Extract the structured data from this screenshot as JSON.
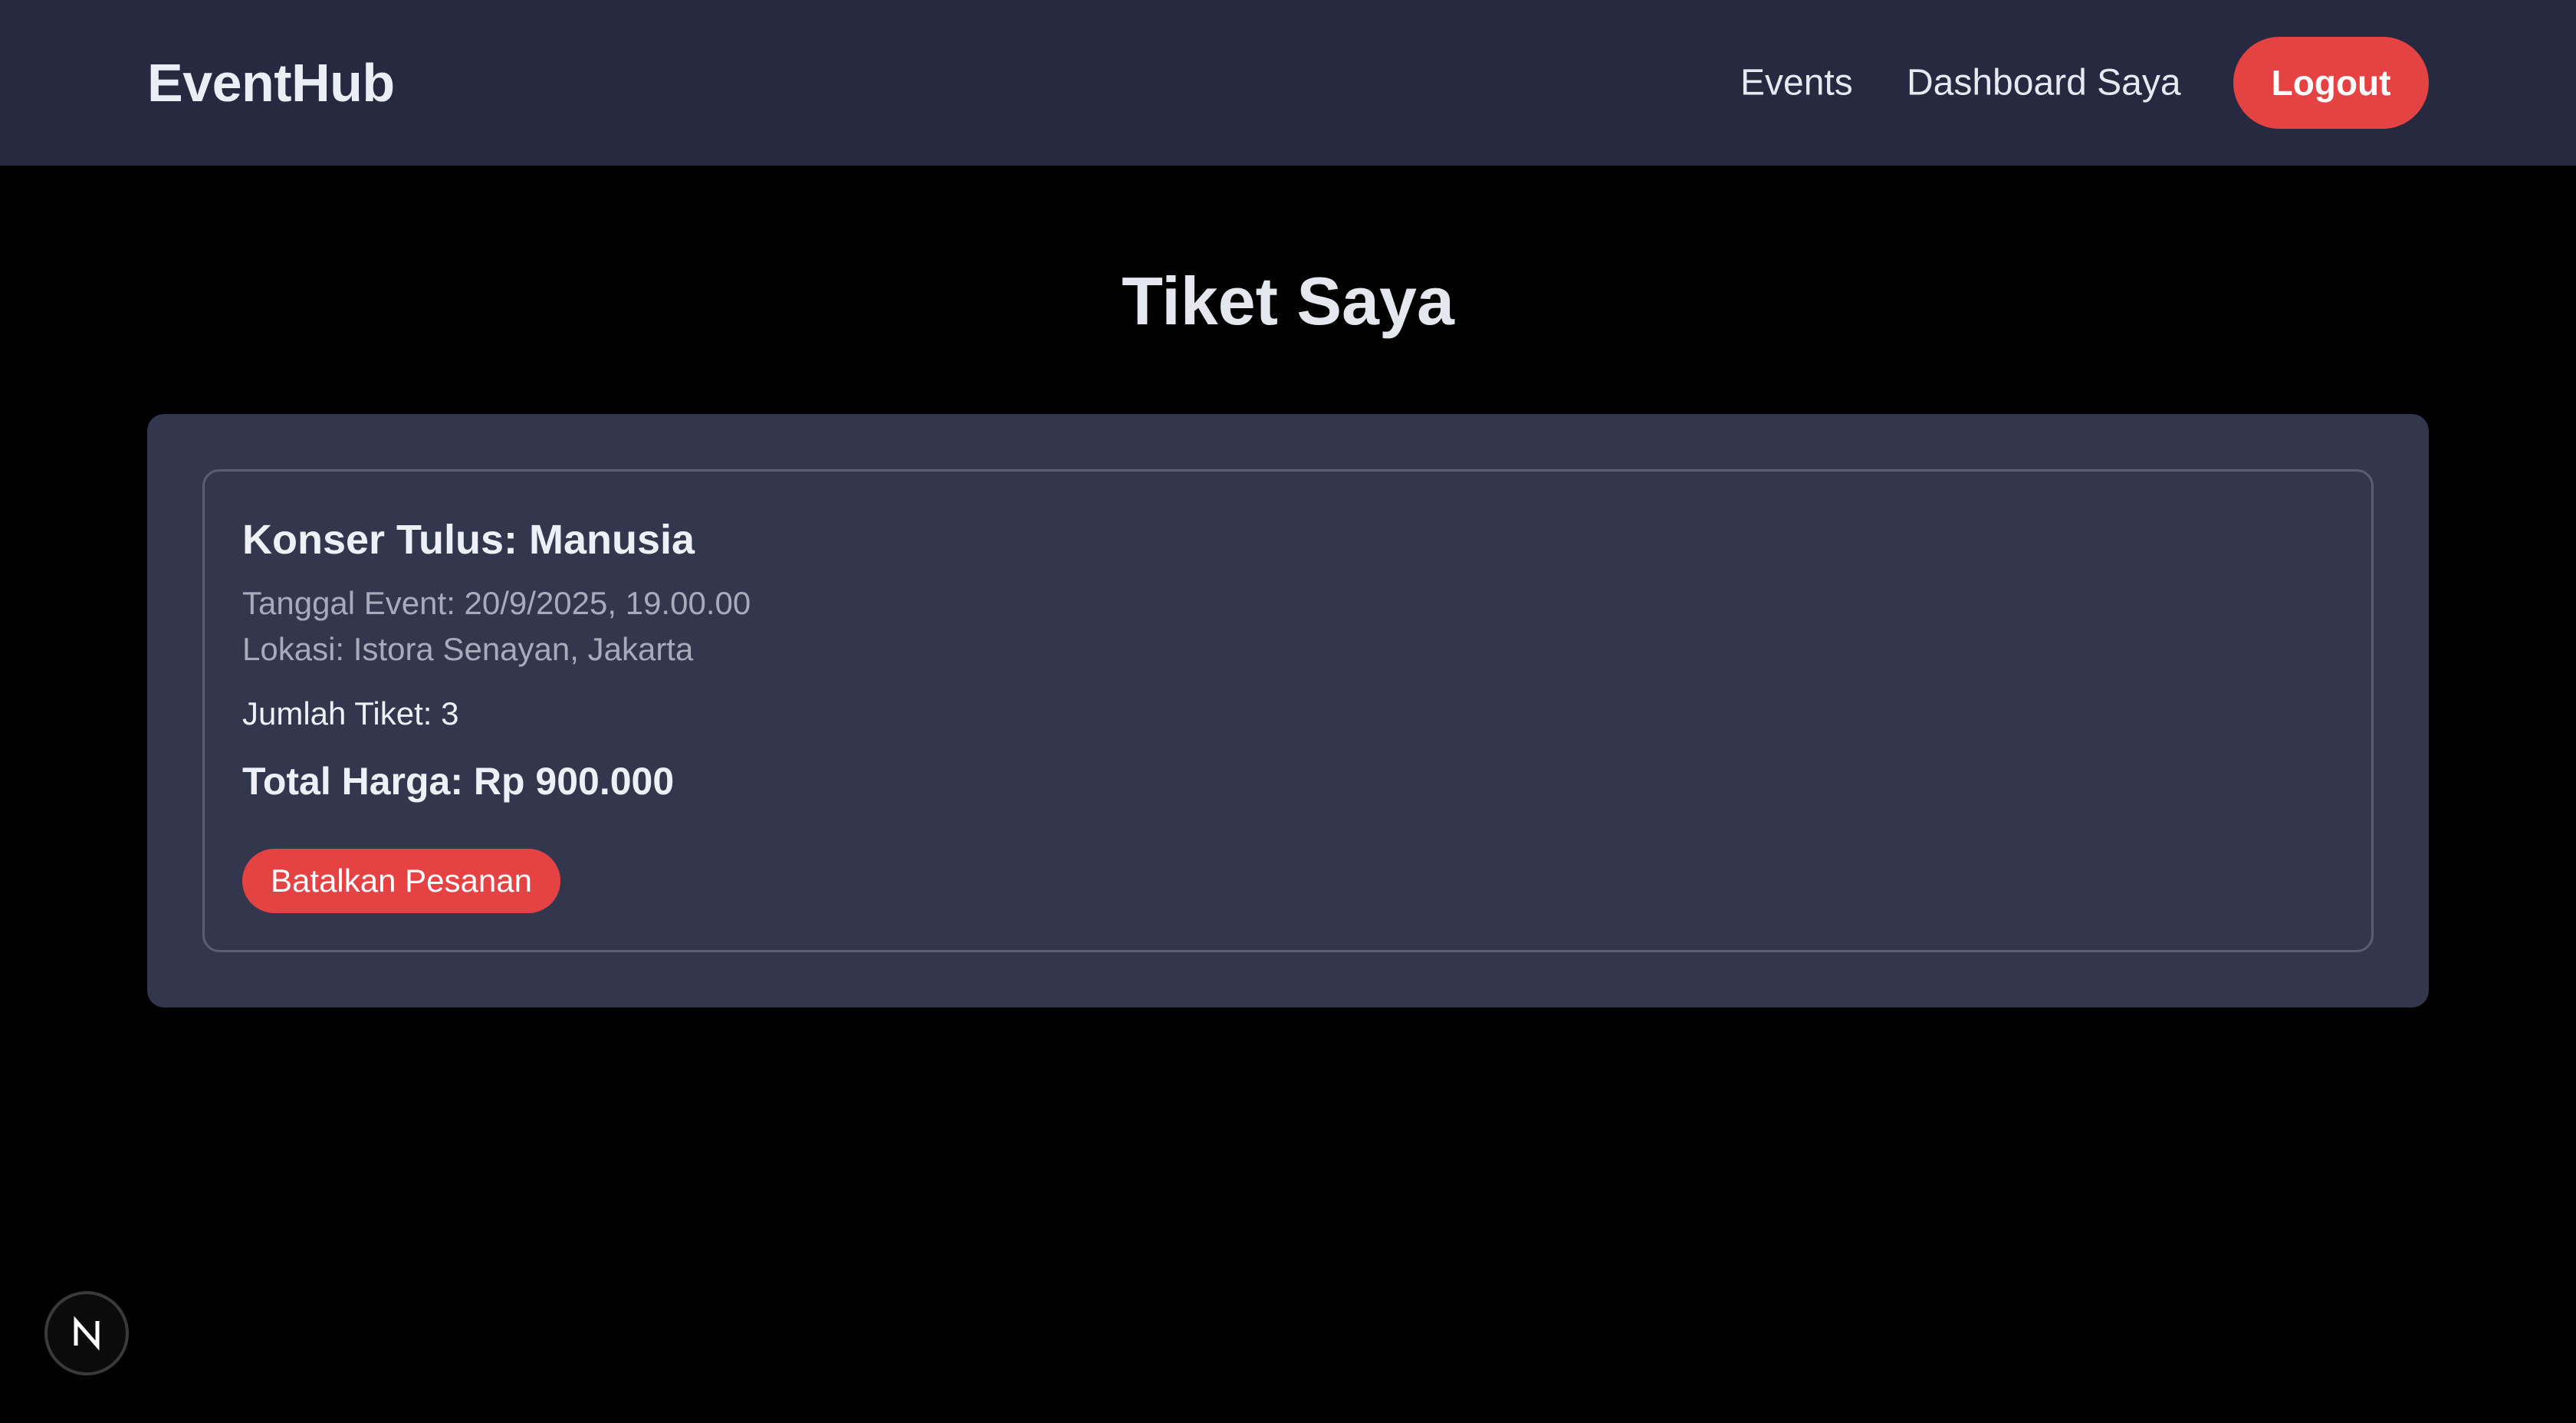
{
  "header": {
    "brand": "EventHub",
    "nav": {
      "events": "Events",
      "dashboard": "Dashboard Saya"
    },
    "logout_label": "Logout"
  },
  "main": {
    "title": "Tiket Saya",
    "tickets": [
      {
        "event_name": "Konser Tulus: Manusia",
        "date_line": "Tanggal Event: 20/9/2025, 19.00.00",
        "location_line": "Lokasi: Istora Senayan, Jakarta",
        "quantity_line": "Jumlah Tiket: 3",
        "total_line": "Total Harga: Rp 900.000",
        "cancel_label": "Batalkan Pesanan"
      }
    ]
  },
  "dev_indicator": {
    "icon": "nextjs-n-icon",
    "letter": "N"
  },
  "colors": {
    "header_bg": "#26293f",
    "page_bg": "#000000",
    "panel_bg": "#33374d",
    "accent_red": "#e54343"
  }
}
